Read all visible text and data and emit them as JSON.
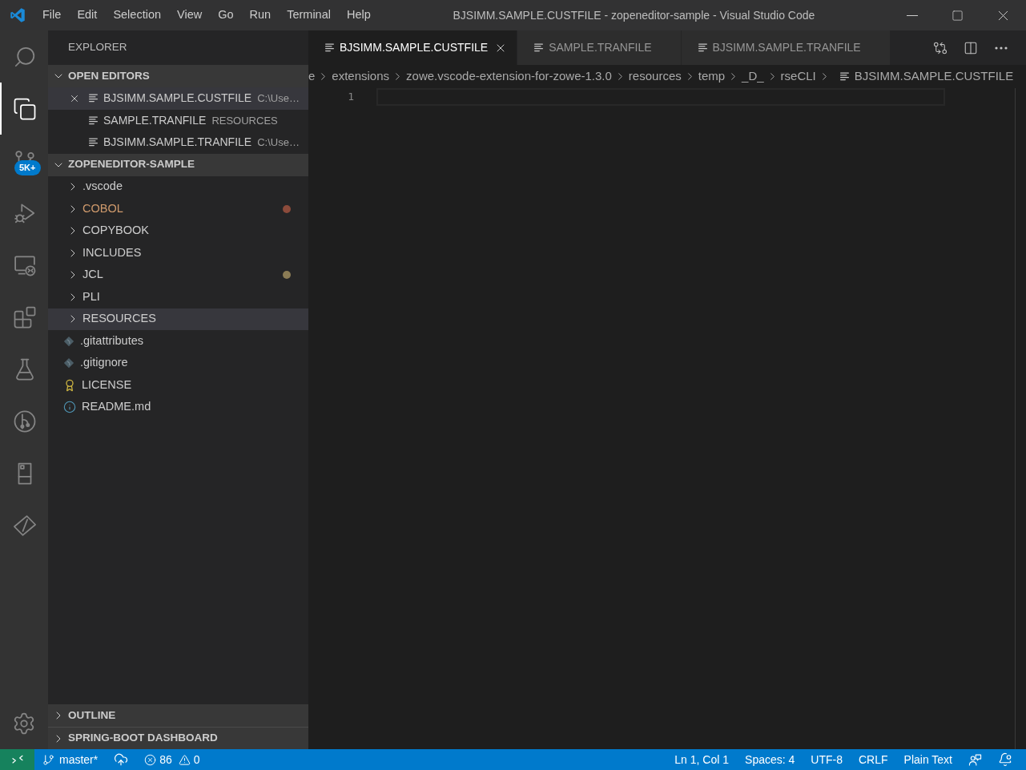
{
  "title_bar": {
    "menu": [
      "File",
      "Edit",
      "Selection",
      "View",
      "Go",
      "Run",
      "Terminal",
      "Help"
    ],
    "title": "BJSIMM.SAMPLE.CUSTFILE - zopeneditor-sample - Visual Studio Code"
  },
  "activity_bar": {
    "items": [
      {
        "kind": "search",
        "selected": false
      },
      {
        "kind": "explorer",
        "selected": true
      },
      {
        "kind": "source-control",
        "selected": false,
        "badge": "5K+"
      },
      {
        "kind": "run",
        "selected": false
      },
      {
        "kind": "remote",
        "selected": false
      },
      {
        "kind": "extensions",
        "selected": false
      },
      {
        "kind": "testing",
        "selected": false
      },
      {
        "kind": "graph",
        "selected": false
      },
      {
        "kind": "cabinet",
        "selected": false
      },
      {
        "kind": "diamond",
        "selected": false
      }
    ]
  },
  "sidebar": {
    "title": "EXPLORER",
    "open_editors": {
      "title": "OPEN EDITORS",
      "expanded": true,
      "items": [
        {
          "name": "BJSIMM.SAMPLE.CUSTFILE",
          "description": "C:\\Use…",
          "selected": true
        },
        {
          "name": "SAMPLE.TRANFILE",
          "description": "RESOURCES",
          "selected": false
        },
        {
          "name": "BJSIMM.SAMPLE.TRANFILE",
          "description": "C:\\Use…",
          "selected": false
        }
      ]
    },
    "workspace": {
      "title": "ZOPENEDITOR-SAMPLE",
      "expanded": true,
      "items": [
        {
          "kind": "folder",
          "name": ".vscode",
          "expanded": false,
          "selected": false,
          "modified": false
        },
        {
          "kind": "folder",
          "name": "COBOL",
          "expanded": false,
          "selected": false,
          "modified": true,
          "color": "#8c4b3b"
        },
        {
          "kind": "folder",
          "name": "COPYBOOK",
          "expanded": false,
          "selected": false,
          "modified": false
        },
        {
          "kind": "folder",
          "name": "INCLUDES",
          "expanded": false,
          "selected": false,
          "modified": false
        },
        {
          "kind": "folder",
          "name": "JCL",
          "expanded": false,
          "selected": false,
          "modified": false,
          "color": "#8b7c55"
        },
        {
          "kind": "folder",
          "name": "PLI",
          "expanded": false,
          "selected": false,
          "modified": false
        },
        {
          "kind": "folder",
          "name": "RESOURCES",
          "expanded": false,
          "selected": true,
          "modified": false
        },
        {
          "kind": "git",
          "name": ".gitattributes",
          "selected": false,
          "modified": false
        },
        {
          "kind": "git",
          "name": ".gitignore",
          "selected": false,
          "modified": false
        },
        {
          "kind": "license",
          "name": "LICENSE",
          "selected": false,
          "modified": false
        },
        {
          "kind": "info",
          "name": "README.md",
          "selected": false,
          "modified": false
        }
      ]
    },
    "bottom_sections": [
      {
        "title": "OUTLINE",
        "expanded": false
      },
      {
        "title": "SPRING-BOOT DASHBOARD",
        "expanded": false
      }
    ]
  },
  "editor": {
    "tabs": [
      {
        "label": "BJSIMM.SAMPLE.CUSTFILE",
        "selected": true
      },
      {
        "label": "SAMPLE.TRANFILE",
        "selected": false
      },
      {
        "label": "BJSIMM.SAMPLE.TRANFILE",
        "selected": false
      }
    ],
    "breadcrumbs": [
      {
        "kind": "folder",
        "label": "e"
      },
      {
        "kind": "folder",
        "label": "extensions"
      },
      {
        "kind": "folder",
        "label": "zowe.vscode-extension-for-zowe-1.3.0"
      },
      {
        "kind": "folder",
        "label": "resources"
      },
      {
        "kind": "folder",
        "label": "temp"
      },
      {
        "kind": "folder",
        "label": "_D_"
      },
      {
        "kind": "folder",
        "label": "rseCLI"
      },
      {
        "kind": "file",
        "label": "BJSIMM.SAMPLE.CUSTFILE"
      }
    ],
    "line_numbers": [
      "1"
    ]
  },
  "status_bar": {
    "branch": "master*",
    "errors": "86",
    "warnings": "0",
    "items": [
      "Ln 1, Col 1",
      "Spaces: 4",
      "UTF-8",
      "CRLF",
      "Plain Text"
    ],
    "notifications_unread": true
  }
}
